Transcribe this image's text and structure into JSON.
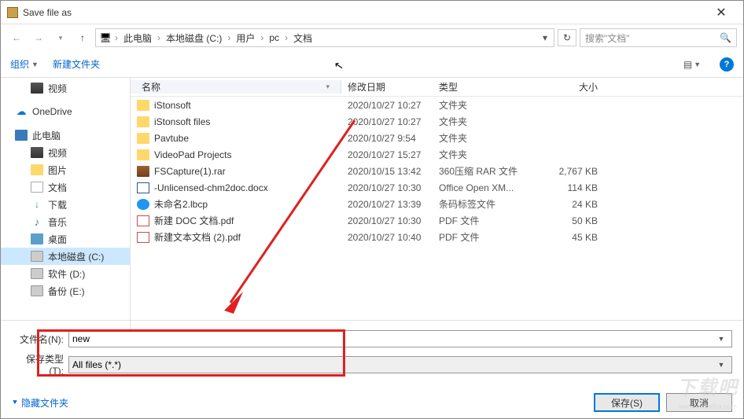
{
  "window": {
    "title": "Save file as"
  },
  "nav": {
    "crumbs": [
      "此电脑",
      "本地磁盘 (C:)",
      "用户",
      "pc",
      "文档"
    ],
    "search_placeholder": "搜索\"文档\""
  },
  "toolbar": {
    "organize": "组织",
    "newfolder": "新建文件夹"
  },
  "sidebar": {
    "items": [
      {
        "label": "视频",
        "icon": "film",
        "level": 2
      },
      {
        "label": "OneDrive",
        "icon": "cloud",
        "level": 1
      },
      {
        "label": "此电脑",
        "icon": "pc",
        "level": 1
      },
      {
        "label": "视频",
        "icon": "film",
        "level": 2
      },
      {
        "label": "图片",
        "icon": "folder",
        "level": 2
      },
      {
        "label": "文档",
        "icon": "doc",
        "level": 2
      },
      {
        "label": "下载",
        "icon": "down",
        "level": 2
      },
      {
        "label": "音乐",
        "icon": "music",
        "level": 2
      },
      {
        "label": "桌面",
        "icon": "desktop",
        "level": 2
      },
      {
        "label": "本地磁盘 (C:)",
        "icon": "drive",
        "level": 2,
        "selected": true
      },
      {
        "label": "软件 (D:)",
        "icon": "drive",
        "level": 2
      },
      {
        "label": "备份 (E:)",
        "icon": "drive",
        "level": 2
      }
    ]
  },
  "columns": {
    "name": "名称",
    "date": "修改日期",
    "type": "类型",
    "size": "大小"
  },
  "files": [
    {
      "name": "iStonsoft",
      "date": "2020/10/27 10:27",
      "type": "文件夹",
      "size": "",
      "icon": "folder"
    },
    {
      "name": "iStonsoft files",
      "date": "2020/10/27 10:27",
      "type": "文件夹",
      "size": "",
      "icon": "folder"
    },
    {
      "name": "Pavtube",
      "date": "2020/10/27 9:54",
      "type": "文件夹",
      "size": "",
      "icon": "folder"
    },
    {
      "name": "VideoPad Projects",
      "date": "2020/10/27 15:27",
      "type": "文件夹",
      "size": "",
      "icon": "folder"
    },
    {
      "name": "FSCapture(1).rar",
      "date": "2020/10/15 13:42",
      "type": "360压缩 RAR 文件",
      "size": "2,767 KB",
      "icon": "rar"
    },
    {
      "name": "-Unlicensed-chm2doc.docx",
      "date": "2020/10/27 10:30",
      "type": "Office Open XM...",
      "size": "114 KB",
      "icon": "docx"
    },
    {
      "name": "未命名2.lbcp",
      "date": "2020/10/27 13:39",
      "type": "条码标签文件",
      "size": "24 KB",
      "icon": "lbcp"
    },
    {
      "name": "新建 DOC 文档.pdf",
      "date": "2020/10/27 10:30",
      "type": "PDF 文件",
      "size": "50 KB",
      "icon": "pdf"
    },
    {
      "name": "新建文本文档 (2).pdf",
      "date": "2020/10/27 10:40",
      "type": "PDF 文件",
      "size": "45 KB",
      "icon": "pdf"
    }
  ],
  "save": {
    "filename_label": "文件名(N):",
    "filename_value": "new",
    "filetype_label": "保存类型(T):",
    "filetype_value": "All files (*.*)",
    "hide_folders": "隐藏文件夹",
    "save_btn": "保存(S)",
    "cancel_btn": "取消"
  },
  "watermark": {
    "main": "下载吧",
    "sub": "www.xiazaiba.com"
  }
}
